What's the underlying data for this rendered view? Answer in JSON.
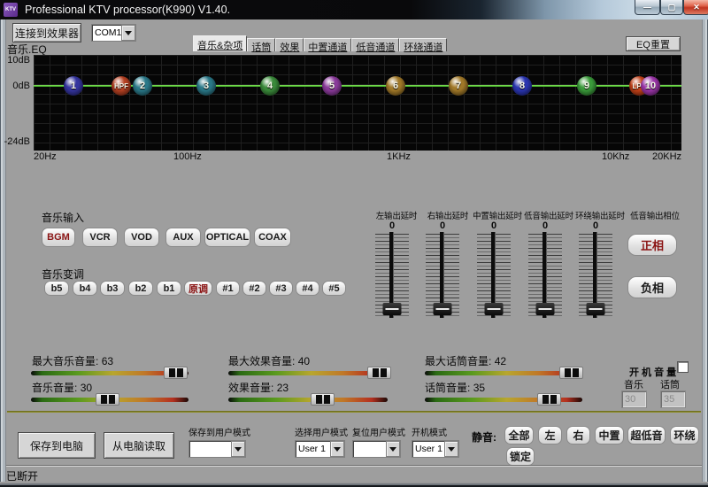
{
  "window": {
    "title": "Professional KTV processor(K990) V1.40.",
    "icon_text": "KTV"
  },
  "toolbar": {
    "connect_button": "连接到效果器",
    "com_port": "COM1"
  },
  "tabs": [
    "音乐&杂项",
    "话筒",
    "效果",
    "中置通道",
    "低音通道",
    "环绕通道"
  ],
  "eq": {
    "section_label": "音乐.EQ",
    "reset_button": "EQ重置",
    "db_labels": [
      "10dB",
      "0dB",
      "-24dB"
    ],
    "freq_labels": [
      "20Hz",
      "100Hz",
      "1KHz",
      "10Khz",
      "20KHz"
    ],
    "line_color": "#4fce2a",
    "balls": [
      {
        "label": "1",
        "color": "#34349e"
      },
      {
        "label": "HPF",
        "color": "#b44022"
      },
      {
        "label": "2",
        "color": "#2a7888"
      },
      {
        "label": "3",
        "color": "#2a7888"
      },
      {
        "label": "4",
        "color": "#3a8a3a"
      },
      {
        "label": "5",
        "color": "#8a3a9a"
      },
      {
        "label": "6",
        "color": "#a07828"
      },
      {
        "label": "7",
        "color": "#a07828"
      },
      {
        "label": "8",
        "color": "#2a35b0"
      },
      {
        "label": "9",
        "color": "#3a9a3a"
      },
      {
        "label": "LPF",
        "color": "#c04018"
      },
      {
        "label": "10",
        "color": "#9a35a8"
      }
    ]
  },
  "music_input": {
    "label": "音乐输入",
    "buttons": [
      "BGM",
      "VCR",
      "VOD",
      "AUX",
      "OPTICAL",
      "COAX"
    ],
    "active": "BGM",
    "active_color": "#8b1414"
  },
  "pitch": {
    "label": "音乐变调",
    "buttons": [
      "b5",
      "b4",
      "b3",
      "b2",
      "b1",
      "原调",
      "#1",
      "#2",
      "#3",
      "#4",
      "#5"
    ],
    "active": "原调"
  },
  "delays": {
    "columns": [
      {
        "label": "左输出延时",
        "value": "0"
      },
      {
        "label": "右输出延时",
        "value": "0"
      },
      {
        "label": "中置输出延时",
        "value": "0"
      },
      {
        "label": "低音输出延时",
        "value": "0"
      },
      {
        "label": "环绕输出延时",
        "value": "0"
      }
    ]
  },
  "phase": {
    "label": "低音输出相位",
    "positive": "正相",
    "negative": "负相",
    "active": "正相"
  },
  "volumes": {
    "sliders": [
      {
        "label": "最大音乐音量:",
        "value": "63"
      },
      {
        "label": "音乐音量:",
        "value": "30"
      },
      {
        "label": "最大效果音量:",
        "value": "40"
      },
      {
        "label": "效果音量:",
        "value": "23"
      },
      {
        "label": "最大话筒音量:",
        "value": "42"
      },
      {
        "label": "话筒音量:",
        "value": "35"
      }
    ]
  },
  "power_on": {
    "label": "开 机 音 量",
    "music_label": "音乐",
    "mic_label": "话筒",
    "music_value": "30",
    "mic_value": "35"
  },
  "bottom": {
    "save_pc": "保存到电脑",
    "read_pc": "从电脑读取",
    "dropdowns": [
      {
        "label": "保存到用户模式",
        "value": ""
      },
      {
        "label": "选择用户模式",
        "value": "User 1"
      },
      {
        "label": "复位用户模式",
        "value": ""
      },
      {
        "label": "开机模式",
        "value": "User 1"
      }
    ],
    "mute": {
      "label": "静音:",
      "buttons": [
        "全部",
        "左",
        "右",
        "中置",
        "超低音",
        "环绕"
      ],
      "lock": "锁定"
    }
  },
  "statusbar": {
    "text": "已断开"
  }
}
